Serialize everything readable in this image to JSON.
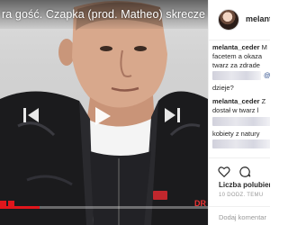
{
  "video": {
    "title": "ra gość. Czapka (prod. Matheo) skrecze dj F",
    "progress_fraction": 0.19,
    "brand_tail": "DR"
  },
  "profile": {
    "username": "melanta"
  },
  "comments": [
    {
      "user": "melanta_ceder",
      "text": "M"
    },
    {
      "text": "facetem a okaza"
    },
    {
      "text": "twarz za zdrade"
    },
    {
      "mention": "@r"
    },
    {
      "text": "dzieje?"
    },
    {
      "user": "melanta_ceder",
      "text": "Z"
    },
    {
      "text": "dostał w twarz l"
    },
    {
      "text": "kobiety z natury"
    }
  ],
  "post": {
    "likes_label": "Liczba polubień",
    "date": "10 DODZ. TEMU",
    "add_comment_placeholder": "Dodaj komentar"
  },
  "colors": {
    "progress": "#e0161c",
    "link": "#2a4a8a"
  },
  "icons": [
    "prev-icon",
    "play-icon",
    "next-icon",
    "heart-icon",
    "comment-icon"
  ]
}
